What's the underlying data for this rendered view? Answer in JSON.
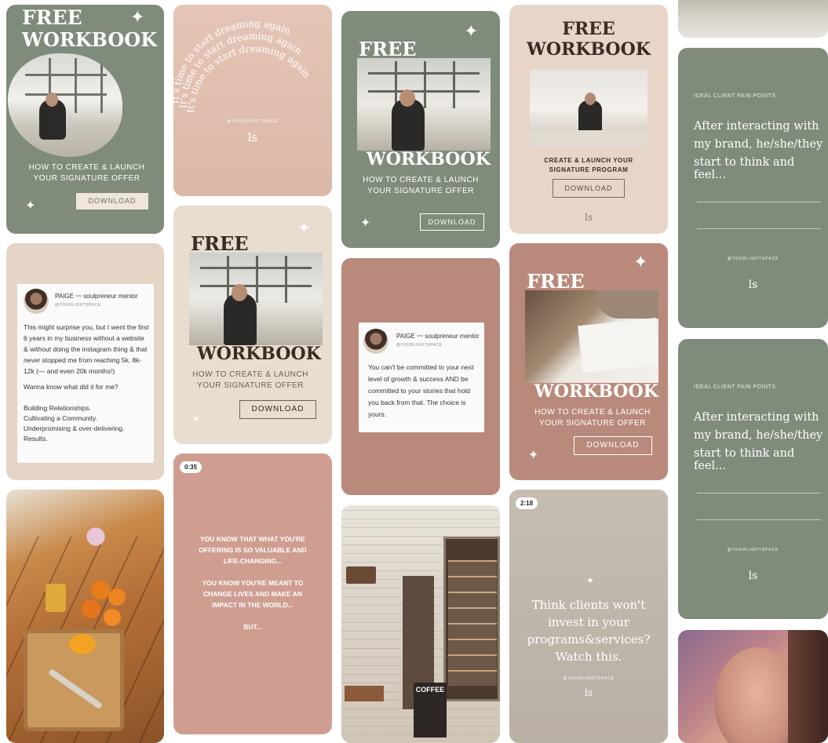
{
  "colors": {
    "sage": "#7f8b7b",
    "blush": "#e7cfc1",
    "rose": "#b98a7b",
    "cream": "#e9ddd0"
  },
  "pins": {
    "p1": {
      "title1": "FREE",
      "title2": "WORKBOOK",
      "sub1": "HOW TO CREATE & LAUNCH",
      "sub2": "YOUR SIGNATURE OFFER",
      "button": "DOWNLOAD"
    },
    "p2": {
      "arc1": "It's time to start dreaming again",
      "arc2": "It's time to start dreaming again",
      "arc3": "It's time to start dreaming again",
      "handle": "@YOURLIGHTSPACE",
      "logo": "ls"
    },
    "p3": {
      "name": "PAIGE 〰 soulpreneur mentor",
      "handle": "@YOURLIGHTSPACE",
      "body1": "This might surprise you, but I went the first 6 years in my business without a website & without doing the instagram thing & that never stopped me from reaching 5k, 8k-12k (— and even 20k months!)",
      "body2": "Wanna know what did it for me?",
      "body3": "Building Relationships.",
      "body4": "Cultivating a Community.",
      "body5": "Underpromising & over-delivering.",
      "body6": "Results."
    },
    "p5": {
      "title1": "FREE",
      "title2": "WORKBOOK",
      "sub1": "HOW TO CREATE & LAUNCH",
      "sub2": "YOUR SIGNATURE OFFER",
      "button": "DOWNLOAD"
    },
    "p6": {
      "badge": "0:35",
      "l1": "YOU KNOW THAT WHAT YOU'RE",
      "l2": "OFFERING IS SO VALUABLE AND",
      "l3": "LIFE-CHANGING...",
      "l4": "YOU KNOW YOU'RE MEANT TO",
      "l5": "CHANGE LIVES AND MAKE AN",
      "l6": "IMPACT IN THE WORLD...",
      "l7": "BUT..."
    },
    "p7": {
      "title1": "FREE",
      "title2": "WORKBOOK",
      "sub1": "HOW TO CREATE & LAUNCH",
      "sub2": "YOUR SIGNATURE OFFER",
      "button": "DOWNLOAD"
    },
    "p8": {
      "name": "PAIGE 〰 soulpreneur mentor",
      "handle": "@YOURLIGHTSPACE",
      "body": "You can't be committed to your next level of growth & success AND be committed to your stories that hold you back from that. The choice is yours."
    },
    "p9": {
      "sign": "COFFEE"
    },
    "p10": {
      "title1": "FREE",
      "title2": "WORKBOOK",
      "sub1": "CREATE & LAUNCH YOUR",
      "sub2": "SIGNATURE PROGRAM",
      "button": "DOWNLOAD",
      "logo": "ls"
    },
    "p11": {
      "title1": "FREE",
      "title2": "WORKBOOK",
      "sub1": "HOW TO CREATE & LAUNCH",
      "sub2": "YOUR SIGNATURE OFFER",
      "button": "DOWNLOAD"
    },
    "p12": {
      "badge": "2:18",
      "l1": "Think clients won't",
      "l2": "invest in your",
      "l3": "programs&services?",
      "l4": "Watch this.",
      "handle": "@YOURLIGHTSPACE",
      "logo": "ls"
    },
    "p13": {
      "label": "IDEAL CLIENT PAIN POINTS",
      "l1": "After interacting with",
      "l2": "my brand, he/she/they",
      "l3": "start to think and feel...",
      "handle": "@YOURLIGHTSPACE",
      "logo": "ls"
    },
    "p14": {
      "label": "IDEAL CLIENT PAIN POINTS",
      "l1": "After interacting with",
      "l2": "my brand, he/she/they",
      "l3": "start to think and feel...",
      "handle": "@YOURLIGHTSPACE",
      "logo": "ls"
    }
  }
}
